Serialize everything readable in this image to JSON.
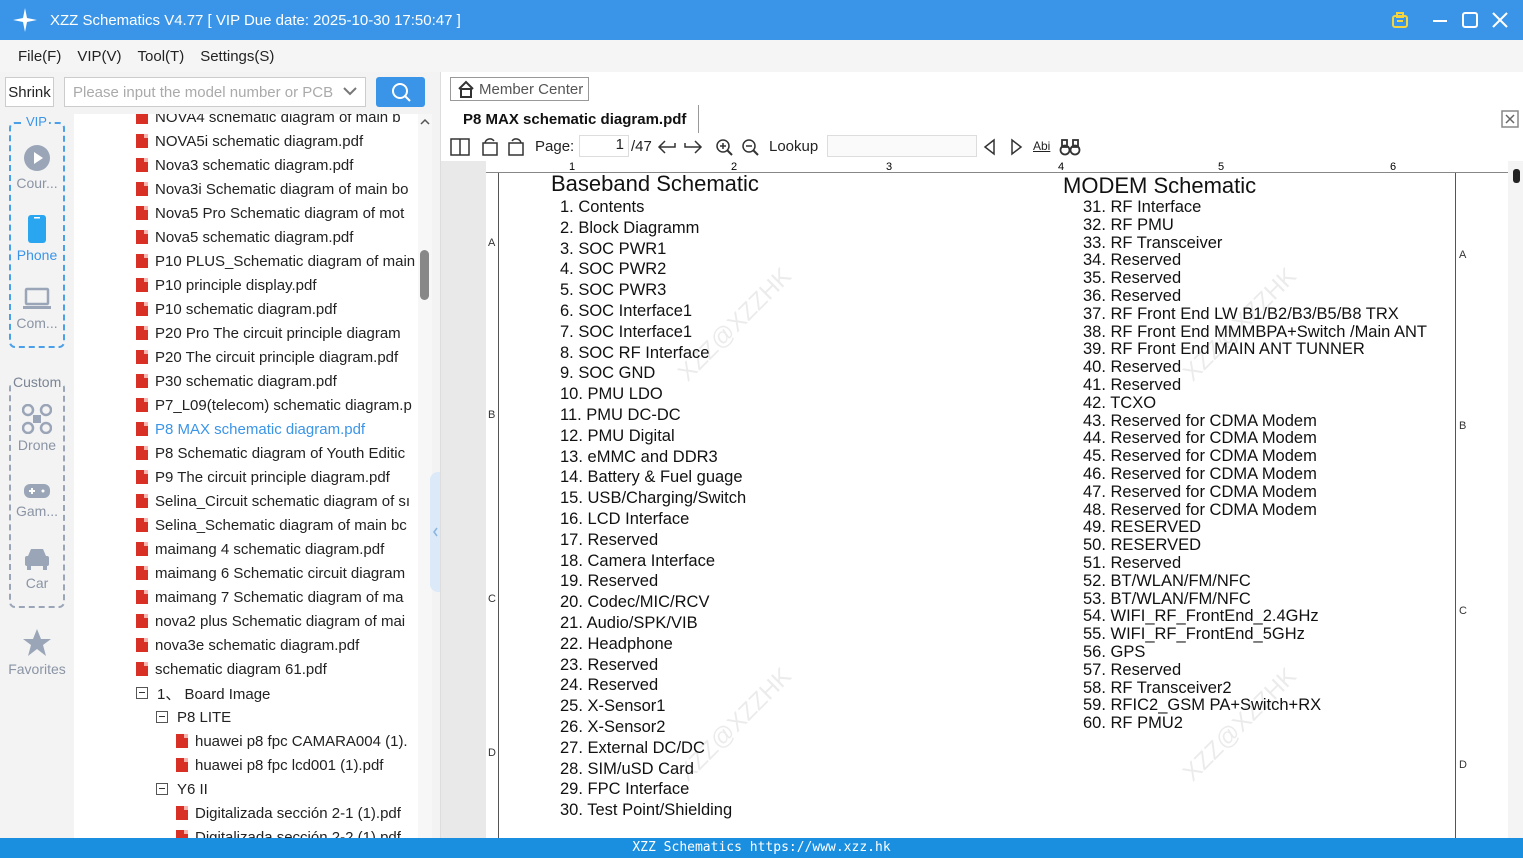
{
  "titlebar": {
    "title": "XZZ Schematics V4.77 [ VIP Due date: 2025-10-30 17:50:47 ]"
  },
  "menu": [
    "File(F)",
    "VIP(V)",
    "Tool(T)",
    "Settings(S)"
  ],
  "search": {
    "shrink_label": "Shrink",
    "placeholder": "Please input the model number or PCB"
  },
  "sidebar": {
    "vip_label": "VIP",
    "custom_label": "Custom",
    "items": [
      {
        "label": "Cour...",
        "icon": "play-circle-icon"
      },
      {
        "label": "Phone",
        "icon": "phone-icon"
      },
      {
        "label": "Com...",
        "icon": "laptop-icon"
      },
      {
        "label": "Drone",
        "icon": "drone-icon"
      },
      {
        "label": "Gam...",
        "icon": "gamepad-icon"
      },
      {
        "label": "Car",
        "icon": "car-icon"
      },
      {
        "label": "Favorites",
        "icon": "star-icon"
      }
    ]
  },
  "tree": {
    "files": [
      "NOVA4 schematic diagram of main b",
      "NOVA5i schematic diagram.pdf",
      "Nova3 schematic diagram.pdf",
      "Nova3i Schematic diagram of main bo",
      "Nova5 Pro Schematic diagram of mot",
      "Nova5 schematic diagram.pdf",
      "P10 PLUS_Schematic diagram of main",
      "P10 principle display.pdf",
      "P10 schematic diagram.pdf",
      "P20 Pro The circuit principle diagram",
      "P20 The circuit principle diagram.pdf",
      "P30 schematic diagram.pdf",
      "P7_L09(telecom) schematic diagram.p",
      "P8 MAX schematic diagram.pdf",
      "P8 Schematic diagram of Youth Editic",
      "P9 The circuit principle diagram.pdf",
      "Selina_Circuit schematic diagram of sı",
      "Selina_Schematic diagram of main bc",
      "maimang 4 schematic diagram.pdf",
      "maimang 6 Schematic circuit diagram",
      "maimang 7 Schematic diagram of ma",
      "nova2 plus Schematic diagram of mai",
      "nova3e schematic diagram.pdf",
      "schematic diagram 61.pdf"
    ],
    "active_index": 13,
    "folder1": "1、 Board Image",
    "sub1": "P8 LITE",
    "sub1_files": [
      "huawei p8 fpc CAMARA004 (1).",
      "huawei p8 fpc lcd001 (1).pdf"
    ],
    "sub2": "Y6 II",
    "sub2_files": [
      "Digitalizada sección 2-1 (1).pdf",
      "Digitalizada sección 2-2 (1).pdf"
    ]
  },
  "viewer": {
    "member_center": "Member Center",
    "tab_title": "P8 MAX schematic diagram.pdf",
    "page_label": "Page:",
    "page_value": "1",
    "page_total": "/47",
    "lookup_label": "Lookup",
    "abi_label": "Abi"
  },
  "document": {
    "ruler": [
      "1",
      "2",
      "3",
      "4",
      "5",
      "6"
    ],
    "row_letters": [
      "A",
      "B",
      "C",
      "D"
    ],
    "left_title": "Baseband Schematic",
    "left_items": [
      "1. Contents",
      "2. Block Diagramm",
      "3. SOC PWR1",
      "4. SOC PWR2",
      "5. SOC PWR3",
      "6. SOC Interface1",
      "7. SOC Interface1",
      "8. SOC RF Interface",
      "9. SOC GND",
      "10. PMU LDO",
      "11. PMU DC-DC",
      "12. PMU Digital",
      "13. eMMC and DDR3",
      "14. Battery & Fuel guage",
      "15. USB/Charging/Switch",
      "16. LCD Interface",
      "17. Reserved",
      "18. Camera Interface",
      "19. Reserved",
      "20. Codec/MIC/RCV",
      "21. Audio/SPK/VIB",
      "22. Headphone",
      "23. Reserved",
      "24. Reserved",
      "25. X-Sensor1",
      "26. X-Sensor2",
      "27. External DC/DC",
      "28. SIM/uSD Card",
      "29. FPC Interface",
      "30. Test Point/Shielding"
    ],
    "right_title": "MODEM Schematic",
    "right_items": [
      "31. RF Interface",
      "32. RF PMU",
      "33. RF Transceiver",
      "34. Reserved",
      "35. Reserved",
      "36. Reserved",
      "37. RF Front End LW B1/B2/B3/B5/B8 TRX",
      "38. RF Front End  MMMBPA+Switch /Main ANT",
      "39. RF Front End  MAIN ANT TUNNER",
      "40. Reserved",
      "41. Reserved",
      "42. TCXO",
      "43. Reserved for CDMA Modem",
      "44. Reserved for CDMA Modem",
      "45. Reserved for CDMA Modem",
      "46. Reserved for CDMA Modem",
      "47. Reserved for CDMA Modem",
      "48. Reserved for CDMA Modem",
      "49. RESERVED",
      "50. RESERVED",
      "51. Reserved",
      "52. BT/WLAN/FM/NFC",
      "53. BT/WLAN/FM/NFC",
      "54. WIFI_RF_FrontEnd_2.4GHz",
      "55. WIFI_RF_FrontEnd_5GHz",
      "56. GPS",
      "57. Reserved",
      "58. RF Transceiver2",
      "59. RFIC2_GSM PA+Switch+RX",
      "60. RF PMU2"
    ],
    "watermark": "XZZ@XZZHK"
  },
  "status": {
    "text": "XZZ Schematics https://www.xzz.hk"
  },
  "colors": {
    "accent": "#3a95e8",
    "pdf": "#d93025",
    "status": "#1a8fe0"
  }
}
